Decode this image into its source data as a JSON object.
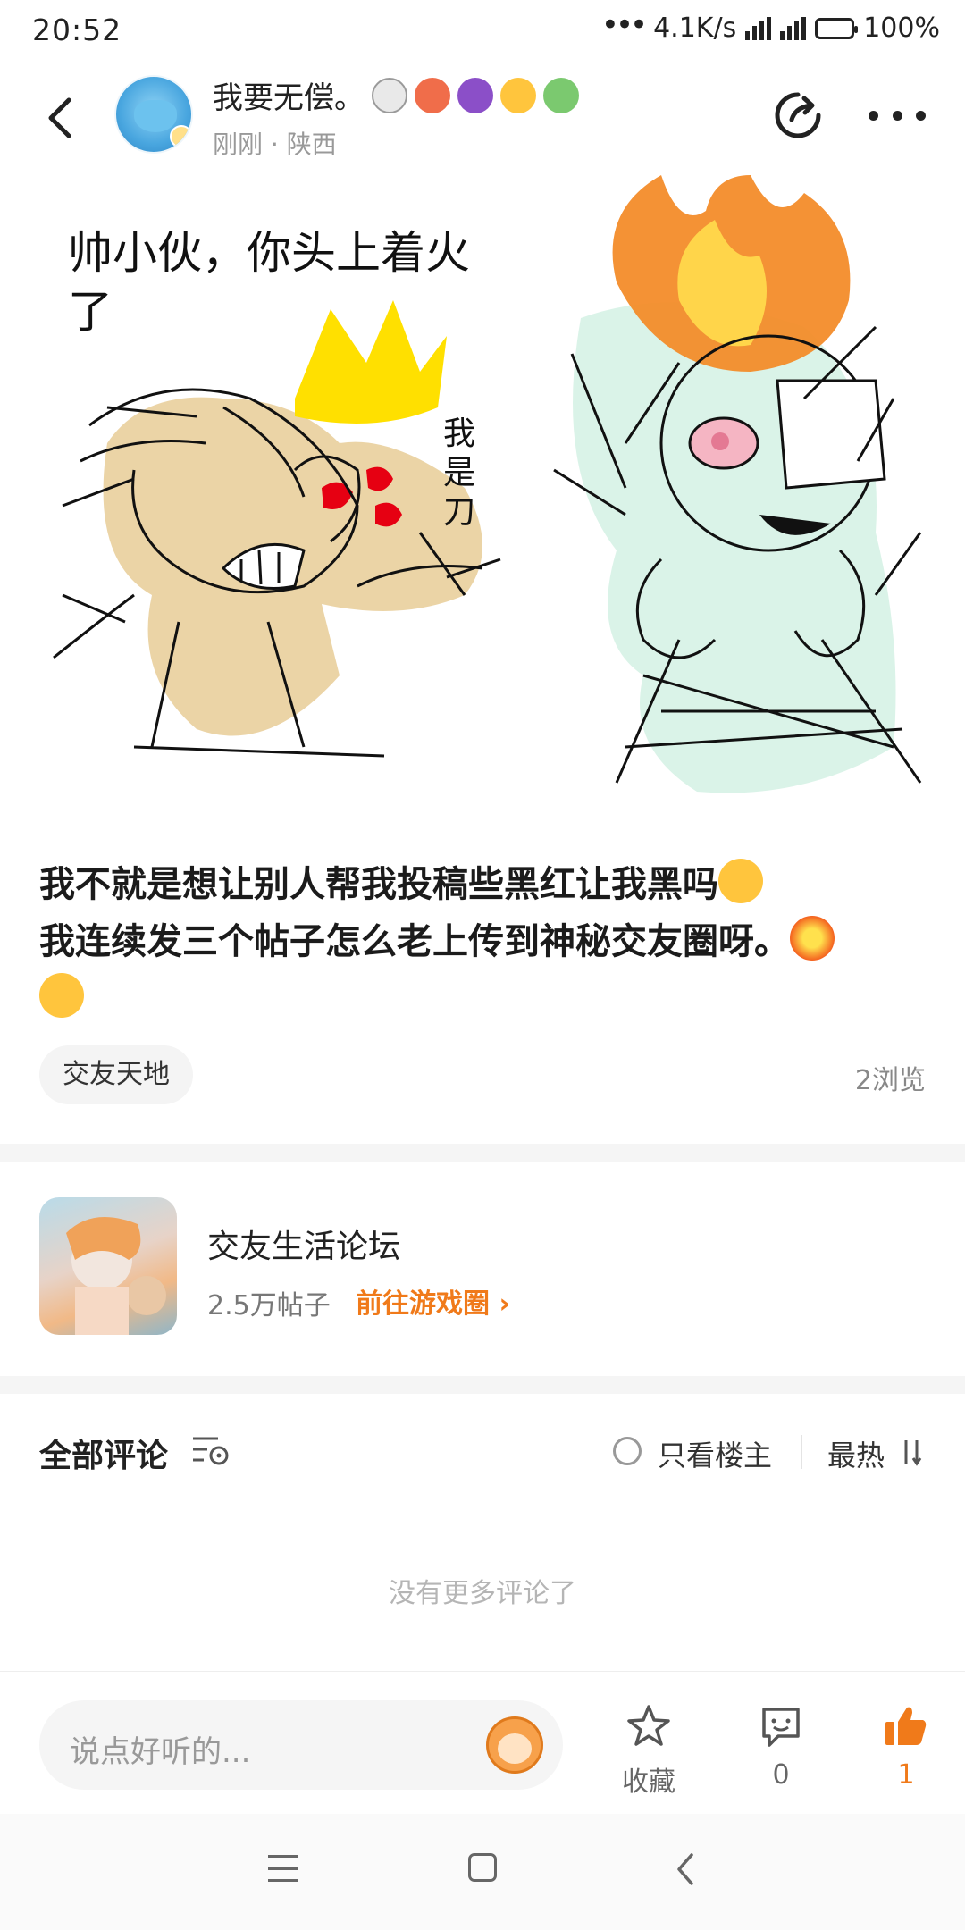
{
  "status_bar": {
    "time": "20:52",
    "net_speed": "4.1K/s",
    "battery": "100%",
    "battery_level": 1.0,
    "battery_color": "#2cc56b"
  },
  "header": {
    "author_name": "我要无偿。",
    "author_emojis": [
      "skull-emoji",
      "angry-emoji",
      "devil-emoji",
      "crying-emoji",
      "vomit-emoji"
    ],
    "meta": "刚刚 · 陕西"
  },
  "drawing": {
    "caption_left": "帅小伙，你头上着火了",
    "caption_small": "我是刀"
  },
  "post": {
    "line1": "我不就是想让别人帮我投稿些黑红让我黑吗",
    "line2": "我连续发三个帖子怎么老上传到神秘交友圈呀。",
    "tag": "交友天地",
    "views": "2浏览"
  },
  "forum": {
    "name": "交友生活论坛",
    "posts": "2.5万帖子",
    "link": "前往游戏圈"
  },
  "comments": {
    "title": "全部评论",
    "owner_only": "只看楼主",
    "sort": "最热",
    "empty": "没有更多评论了"
  },
  "action_bar": {
    "input_placeholder": "说点好听的...",
    "favorite_label": "收藏",
    "comment_count": "0",
    "like_count": "1"
  },
  "colors": {
    "accent": "#f07a1a",
    "text_primary": "#222222",
    "text_secondary": "#999999",
    "separator": "#f5f5f5"
  }
}
